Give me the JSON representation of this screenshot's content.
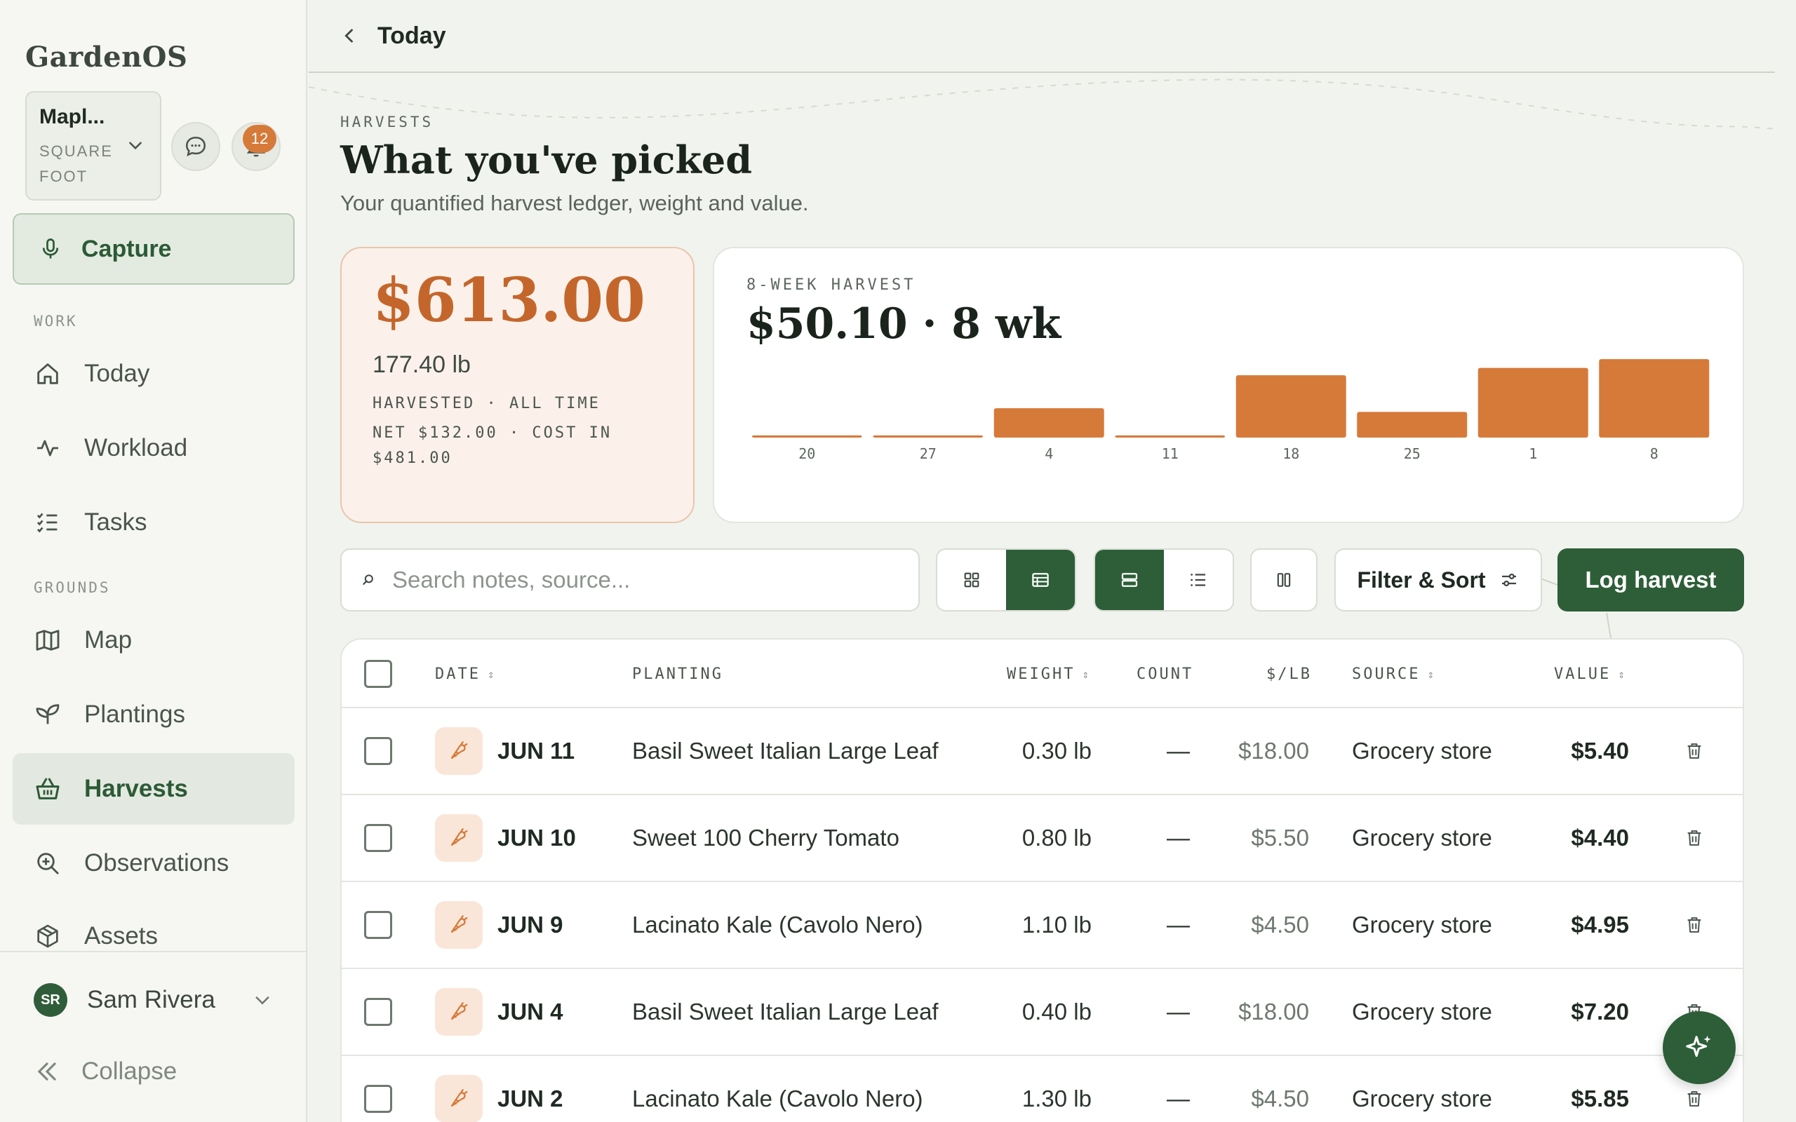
{
  "app": {
    "brand": "GardenOS"
  },
  "garden": {
    "name": "Mapl...",
    "type": "SQUARE FOOT"
  },
  "notifications": {
    "count": "12"
  },
  "capture": {
    "label": "Capture"
  },
  "sidebar": {
    "sections": {
      "work": "WORK",
      "grounds": "GROUNDS"
    },
    "items": [
      {
        "label": "Today",
        "icon": "home-icon"
      },
      {
        "label": "Workload",
        "icon": "activity-icon"
      },
      {
        "label": "Tasks",
        "icon": "checklist-icon"
      },
      {
        "label": "Map",
        "icon": "map-icon"
      },
      {
        "label": "Plantings",
        "icon": "sprout-icon"
      },
      {
        "label": "Harvests",
        "icon": "basket-icon",
        "active": true
      },
      {
        "label": "Observations",
        "icon": "zoom-icon"
      },
      {
        "label": "Assets",
        "icon": "box-icon"
      }
    ]
  },
  "user": {
    "initials": "SR",
    "name": "Sam Rivera"
  },
  "collapse": {
    "label": "Collapse"
  },
  "topbar": {
    "back_label": "Today"
  },
  "page": {
    "kicker": "HARVESTS",
    "title": "What you've picked",
    "subtitle": "Your quantified harvest ledger, weight and value."
  },
  "summary": {
    "total_value": "$613.00",
    "total_weight": "177.40 lb",
    "scope": "HARVESTED · ALL TIME",
    "net_line": "NET $132.00 · COST IN $481.00"
  },
  "weekly": {
    "kicker": "8-WEEK HARVEST",
    "headline": "$50.10 · 8 wk"
  },
  "chart_data": {
    "type": "bar",
    "categories": [
      "20",
      "27",
      "4",
      "11",
      "18",
      "25",
      "1",
      "8"
    ],
    "values": [
      0.3,
      0.3,
      4.0,
      0.3,
      8.5,
      3.5,
      9.5,
      10.7
    ],
    "color": "#d67a3a",
    "ylim": [
      0,
      11
    ]
  },
  "search": {
    "placeholder": "Search notes, source..."
  },
  "toolbar": {
    "filter_label": "Filter & Sort",
    "log_label": "Log harvest"
  },
  "table": {
    "headers": {
      "date": "DATE",
      "planting": "PLANTING",
      "weight": "WEIGHT",
      "count": "COUNT",
      "price": "$/LB",
      "source": "SOURCE",
      "value": "VALUE"
    },
    "rows": [
      {
        "date": "JUN 11",
        "planting": "Basil Sweet Italian Large Leaf",
        "weight": "0.30 lb",
        "count": "—",
        "price": "$18.00",
        "source": "Grocery store",
        "value": "$5.40"
      },
      {
        "date": "JUN 10",
        "planting": "Sweet 100 Cherry Tomato",
        "weight": "0.80 lb",
        "count": "—",
        "price": "$5.50",
        "source": "Grocery store",
        "value": "$4.40"
      },
      {
        "date": "JUN 9",
        "planting": "Lacinato Kale (Cavolo Nero)",
        "weight": "1.10 lb",
        "count": "—",
        "price": "$4.50",
        "source": "Grocery store",
        "value": "$4.95"
      },
      {
        "date": "JUN 4",
        "planting": "Basil Sweet Italian Large Leaf",
        "weight": "0.40 lb",
        "count": "—",
        "price": "$18.00",
        "source": "Grocery store",
        "value": "$7.20"
      },
      {
        "date": "JUN 2",
        "planting": "Lacinato Kale (Cavolo Nero)",
        "weight": "1.30 lb",
        "count": "—",
        "price": "$4.50",
        "source": "Grocery store",
        "value": "$5.85"
      }
    ]
  }
}
